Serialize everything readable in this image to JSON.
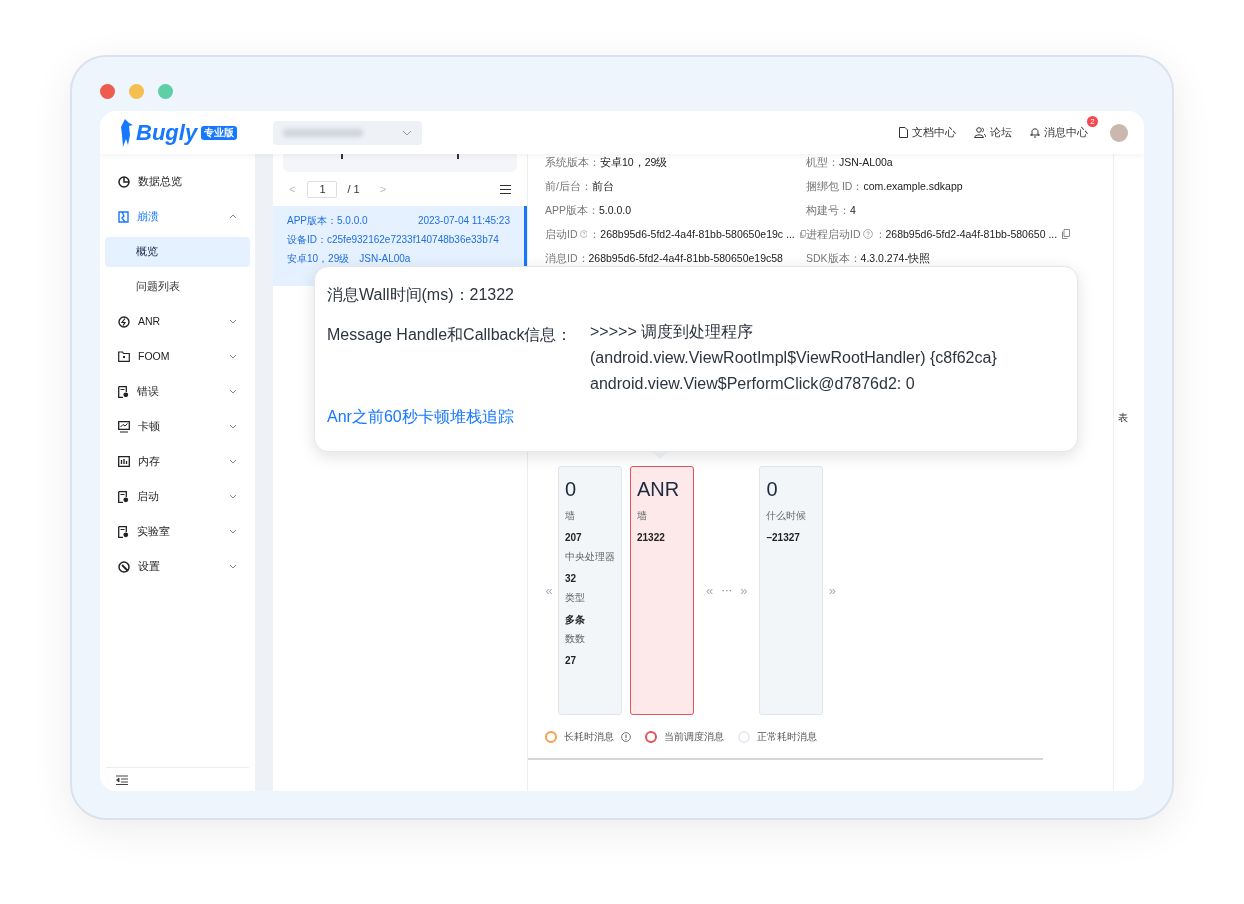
{
  "window": {
    "traffic_lights": [
      {
        "color": "#ee5b4f"
      },
      {
        "color": "#f4bf4f"
      },
      {
        "color": "#5fcfa6"
      }
    ]
  },
  "header": {
    "logo": "Bugly",
    "edition": "专业版",
    "links": [
      {
        "label": "文档中心",
        "kind": "doc"
      },
      {
        "label": "论坛",
        "kind": "users"
      },
      {
        "label": "消息中心",
        "kind": "bell",
        "badge": "2"
      }
    ]
  },
  "sidebar": {
    "items": [
      {
        "label": "数据总览",
        "kind": "pie",
        "selected": false
      },
      {
        "label": "崩溃",
        "kind": "crash",
        "expanded": true,
        "selected": true,
        "children": [
          {
            "label": "概览",
            "selected": true
          },
          {
            "label": "问题列表",
            "selected": false
          }
        ]
      },
      {
        "label": "ANR",
        "kind": "anr",
        "expanded": false,
        "selected": false
      },
      {
        "label": "FOOM",
        "kind": "folder",
        "expanded": false,
        "selected": false
      },
      {
        "label": "错误",
        "kind": "file",
        "expanded": false,
        "selected": false
      },
      {
        "label": "卡顿",
        "kind": "monitor",
        "expanded": false,
        "selected": false
      },
      {
        "label": "内存",
        "kind": "memory",
        "expanded": false,
        "selected": false
      },
      {
        "label": "启动",
        "kind": "file",
        "expanded": false,
        "selected": false
      },
      {
        "label": "实验室",
        "kind": "file",
        "expanded": false,
        "selected": false
      },
      {
        "label": "设置",
        "kind": "gear",
        "expanded": false,
        "selected": false
      }
    ]
  },
  "pager": {
    "prev": "<",
    "page": "1",
    "total": "/ 1",
    "next": ">"
  },
  "reports": [
    {
      "app_version": "APP版本：5.0.0.0",
      "time": "2023-07-04 11:45:23",
      "device_id": "设备ID：c25fe932162e7233f140748b36e33b74",
      "system": "安卓10，29级　JSN-AL00a",
      "selected": true
    }
  ],
  "details": [
    {
      "label": "系统版本：",
      "value": "安卓10，29级"
    },
    {
      "label": "机型：",
      "value": "JSN-AL00a"
    },
    {
      "label": "前/后台：",
      "value": "前台"
    },
    {
      "label": "捆绑包 ID：",
      "value": "com.example.sdkapp"
    },
    {
      "label": "APP版本：",
      "value": "5.0.0.0"
    },
    {
      "label": "构建号：",
      "value": "4"
    },
    {
      "label": "启动ID",
      "help": true,
      "separator": "：",
      "copy": true,
      "value": "268b95d6-5fd2-4a4f-81bb-580650e19c ..."
    },
    {
      "label": "进程启动ID",
      "help": true,
      "separator": "：",
      "copy": true,
      "value": "268b95d6-5fd2-4a4f-81bb-580650 ..."
    },
    {
      "label": "消息ID：",
      "value": "268b95d6-5fd2-4a4f-81bb-580650e19c58"
    },
    {
      "label": "SDK版本：",
      "value": "4.3.0.274-快照"
    }
  ],
  "side_tab": "表",
  "popover": {
    "wall_label": "消息Wall时间(ms)：",
    "wall_value": "21322",
    "handle_label": "Message Handle和Callback信息：",
    "handle_lines": [
      ">>>>> 调度到处理程序",
      "(android.view.ViewRootImpl$ViewRootHandler) {c8f62ca}",
      "android.view.View$PerformClick@d7876d2: 0"
    ],
    "link": "Anr之前60秒卡顿堆栈追踪"
  },
  "timeline": [
    {
      "kind": "nav",
      "text": "«"
    },
    {
      "kind": "card",
      "title": "0",
      "fields": [
        {
          "label": "墙",
          "value": "207"
        },
        {
          "label": "中央处理器",
          "value": "32"
        },
        {
          "label": "类型",
          "value": "多条"
        },
        {
          "label": "数数",
          "value": "27"
        }
      ]
    },
    {
      "kind": "current_card",
      "title": "ANR",
      "fields": [
        {
          "label": "墙",
          "value": "21322"
        }
      ]
    },
    {
      "kind": "gap",
      "prev": "«",
      "more": "···",
      "next": "»"
    },
    {
      "kind": "card",
      "title": "0",
      "fields": [
        {
          "label": "什么时候",
          "value": "–21327"
        }
      ]
    },
    {
      "kind": "nav",
      "text": "»"
    }
  ],
  "legend": [
    {
      "label": "长耗时消息",
      "color": "#f5a04a",
      "info": true
    },
    {
      "label": "当前调度消息",
      "color": "#e5535a"
    },
    {
      "label": "正常耗时消息",
      "color": "#e8ebf1"
    }
  ]
}
